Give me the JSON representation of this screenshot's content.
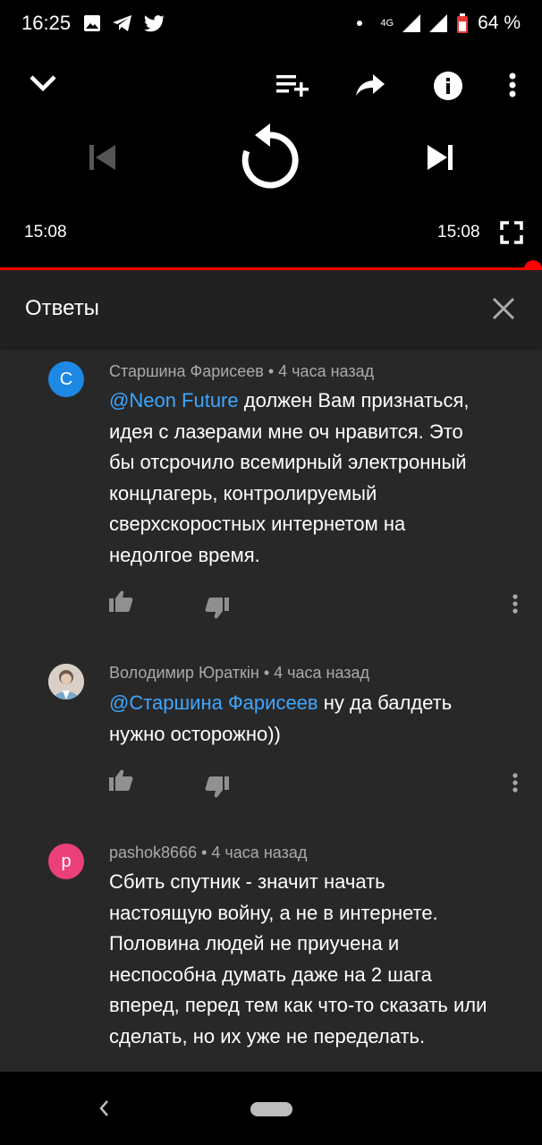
{
  "status_bar": {
    "time": "16:25",
    "network": "4G",
    "battery": "64 %"
  },
  "player": {
    "time_current": "15:08",
    "time_total": "15:08",
    "progress": 1.0,
    "accent_color": "#ff0000"
  },
  "panel": {
    "title": "Ответы"
  },
  "comments": [
    {
      "avatar_letter": "С",
      "avatar_color": "#1e88e5",
      "author": "Старшина Фарисеев",
      "time": "4 часа назад",
      "mention": "@Neon Future",
      "text_after_mention": " должен Вам признаться,",
      "lines": [
        "идея с лазерами мне оч нравится. Это",
        "бы отсрочило всемирный электронный",
        "концлагерь, контролируемый",
        "сверхскоростных интернетом на",
        "недолгое время."
      ]
    },
    {
      "avatar_letter": "",
      "avatar_color": "#d8d0c6",
      "author": "Володимир Юраткін",
      "time": "4 часа назад",
      "mention": "@Старшина Фарисеев",
      "text_after_mention": " ну да балдеть",
      "lines": [
        "нужно осторожно))"
      ]
    },
    {
      "avatar_letter": "p",
      "avatar_color": "#ec407a",
      "author": "pashok8666",
      "time": "4 часа назад",
      "mention": "",
      "text_after_mention": "Сбить спутник - значит начать",
      "lines": [
        "настоящую войну, а не в интернете.",
        "Половина людей не приучена и",
        "неспособна думать даже на 2 шага",
        "вперед, перед тем как что-то сказать или",
        "сделать, но их уже не переделать."
      ]
    }
  ],
  "meta_separator": " • ",
  "icons": {
    "collapse": "chevron-down-icon",
    "add_to_queue": "playlist-add-icon",
    "share": "share-icon",
    "info": "info-icon",
    "more": "more-vert-icon",
    "prev": "skip-previous-icon",
    "replay": "replay-icon",
    "next": "skip-next-icon",
    "fullscreen": "fullscreen-icon",
    "close": "close-icon",
    "like": "thumb-up-icon",
    "dislike": "thumb-down-icon"
  }
}
